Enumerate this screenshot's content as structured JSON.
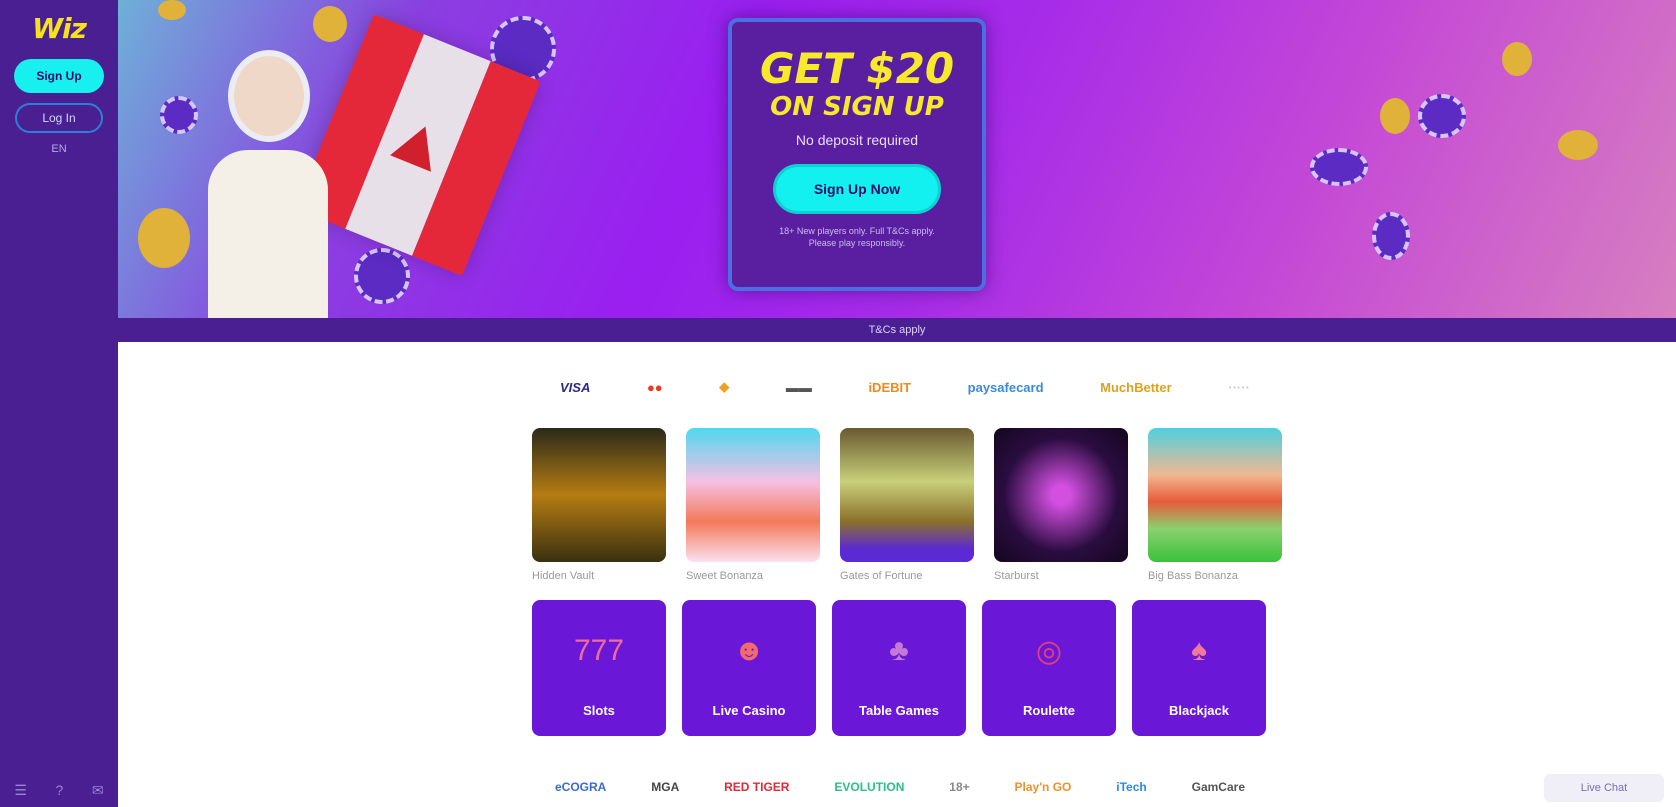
{
  "sidebar": {
    "logo": "Wiz",
    "signup_label": "Sign Up",
    "login_label": "Log In",
    "language": "EN",
    "bottom_icons": [
      "☰",
      "?",
      "✉"
    ]
  },
  "hero": {
    "promo_line1": "GET $20",
    "promo_line2": "ON SIGN UP",
    "promo_sub": "No deposit required",
    "cta_label": "Sign Up Now",
    "terms": "18+ New players only. Full T&Cs apply. Please play responsibly."
  },
  "info_bar": "T&Cs apply",
  "payments": [
    "VISA",
    "●●",
    "◆",
    "▬▬",
    "iDEBIT",
    "paysafecard",
    "MuchBetter",
    "·····"
  ],
  "games": [
    {
      "name": "Hidden Vault",
      "bg": "linear-gradient(#2a2a1a,#b57c12 50%,#3a3010)"
    },
    {
      "name": "Sweet Bonanza",
      "bg": "linear-gradient(#4fd8ef,#f6c0e4 40%,#f37a5a 70%,#fbe0ef)"
    },
    {
      "name": "Gates of Fortune",
      "bg": "linear-gradient(#6a5a30,#c7d07a 40%,#8a6f2a 70%,#5c2ad2 90%)"
    },
    {
      "name": "Starburst",
      "bg": "radial-gradient(circle,#d24fe0 10%,#2a0d40 60%,#14061e)"
    },
    {
      "name": "Big Bass Bonanza",
      "bg": "linear-gradient(#4fd0e0,#f0b890 35%,#e85a3a 55%,#8ad070 75%,#3ac23a)"
    }
  ],
  "categories": [
    {
      "label": "Slots",
      "icon": "777",
      "color": "#f06a9a"
    },
    {
      "label": "Live Casino",
      "icon": "☻",
      "color": "#f26a6a"
    },
    {
      "label": "Table Games",
      "icon": "♣",
      "color": "#c27ad6"
    },
    {
      "label": "Roulette",
      "icon": "◎",
      "color": "#e2407a"
    },
    {
      "label": "Blackjack",
      "icon": "♠",
      "color": "#f07a9a"
    }
  ],
  "partners": [
    "eCOGRA",
    "MGA",
    "RED TIGER",
    "EVOLUTION",
    "18+",
    "Play'n GO",
    "iTech",
    "GamCare"
  ],
  "chat_label": "Live Chat",
  "colors": {
    "sidebar": "#4a1f91",
    "accent": "#18f0f0",
    "promo_text": "#f7ea2a"
  }
}
